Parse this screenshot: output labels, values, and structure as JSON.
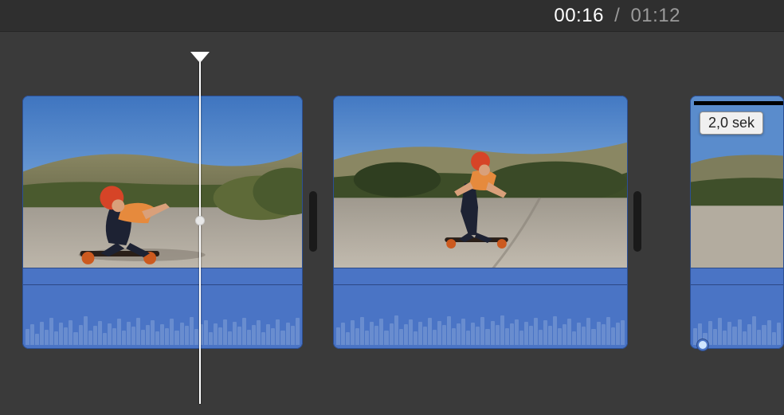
{
  "timecode": {
    "current": "00:16",
    "separator": "/",
    "total": "01:12"
  },
  "clips": {
    "clip1": {
      "label": ""
    },
    "clip2": {
      "label": ""
    },
    "clip3": {
      "label": ""
    }
  },
  "tooltip": {
    "duration": "2,0 sek"
  }
}
